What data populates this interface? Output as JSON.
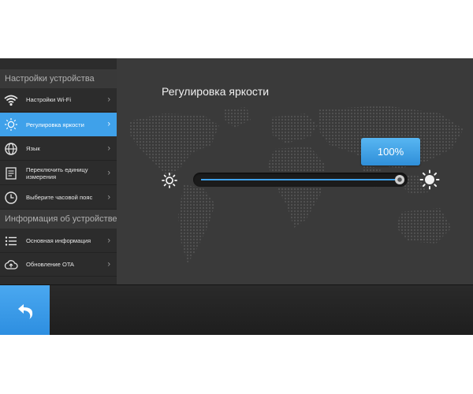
{
  "sidebar": {
    "section1_title": "Настройки устройства",
    "section2_title": "Информация об устройстве",
    "items": [
      {
        "label": "Настройки Wi-Fi",
        "icon": "wifi-icon",
        "active": false
      },
      {
        "label": "Регулировка яркости",
        "icon": "brightness-icon",
        "active": true
      },
      {
        "label": "Язык",
        "icon": "globe-icon",
        "active": false
      },
      {
        "label": "Переключить единицу измерения",
        "icon": "unit-icon",
        "active": false
      },
      {
        "label": "Выберите часовой пояс",
        "icon": "clock-icon",
        "active": false
      },
      {
        "label": "Основная информация",
        "icon": "list-icon",
        "active": false
      },
      {
        "label": "Обновление OTA",
        "icon": "cloud-upload-icon",
        "active": false
      }
    ],
    "chevron": "›"
  },
  "panel": {
    "title": "Регулировка яркости",
    "brightness_label": "100%",
    "brightness_value": 1.0
  },
  "colors": {
    "accent": "#3fa1ea",
    "background": "#3a3a3a",
    "sidebar": "#2c2c2c"
  },
  "bottom_bar": {
    "back_icon": "back-arrow-icon"
  }
}
